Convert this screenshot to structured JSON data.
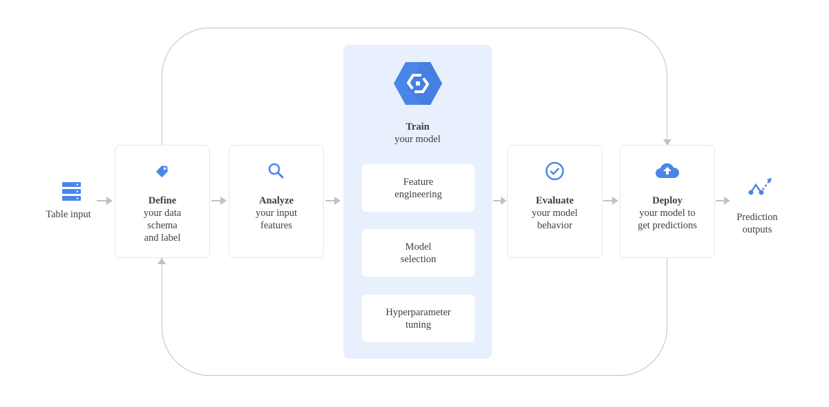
{
  "diagram": {
    "input": {
      "icon": "database-icon",
      "label": "Table input"
    },
    "output": {
      "icon": "prediction-icon",
      "label_lines": [
        "Prediction",
        "outputs"
      ]
    },
    "steps": [
      {
        "icon": "tag-icon",
        "title": "Define",
        "lines": [
          "your data",
          "schema",
          "and label"
        ]
      },
      {
        "icon": "search-icon",
        "title": "Analyze",
        "lines": [
          "your input",
          "features"
        ]
      },
      {
        "icon": "check-circle-icon",
        "title": "Evaluate",
        "lines": [
          "your model",
          "behavior"
        ]
      },
      {
        "icon": "cloud-upload-icon",
        "title": "Deploy",
        "lines": [
          "your model to",
          "get predictions"
        ]
      }
    ],
    "train": {
      "icon": "automl-hexagon-icon",
      "title": "Train",
      "subtitle": "your model",
      "substeps": [
        {
          "lines": [
            "Feature",
            "engineering"
          ]
        },
        {
          "lines": [
            "Model",
            "selection"
          ]
        },
        {
          "lines": [
            "Hyperparameter",
            "tuning"
          ]
        }
      ]
    },
    "colors": {
      "accent": "#4a86e8",
      "arrow": "#b9c3c9",
      "panel": "#e8f0fd"
    }
  }
}
